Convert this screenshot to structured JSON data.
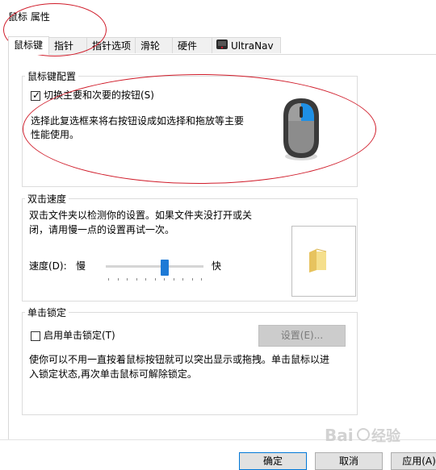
{
  "window": {
    "title": "鼠标 属性"
  },
  "tabs": [
    {
      "label": "鼠标键",
      "active": true
    },
    {
      "label": "指针"
    },
    {
      "label": "指针选项"
    },
    {
      "label": "滑轮"
    },
    {
      "label": "硬件"
    },
    {
      "label": "UltraNav",
      "icon": "ultranav-icon"
    }
  ],
  "button_config": {
    "legend": "鼠标键配置",
    "checkbox_label": "切换主要和次要的按钮(S)",
    "checked": true,
    "description_line1": "选择此复选框来将右按钮设成如选择和拖放等主要",
    "description_line2": "性能使用。",
    "illustration": "mouse-icon"
  },
  "double_click": {
    "legend": "双击速度",
    "description_line1": "双击文件夹以检测你的设置。如果文件夹没打开或关",
    "description_line2": "闭，请用慢一点的设置再试一次。",
    "speed_label": "速度(D):",
    "slow": "慢",
    "fast": "快",
    "speed_fraction": 0.6,
    "test_icon": "folder-icon"
  },
  "click_lock": {
    "legend": "单击锁定",
    "checkbox_label": "启用单击锁定(T)",
    "checked": false,
    "settings_button": "设置(E)...",
    "description_line1": "使你可以不用一直按着鼠标按钮就可以突出显示或拖拽。单击鼠标以进",
    "description_line2": "入锁定状态,再次单击鼠标可解除锁定。"
  },
  "footer": {
    "ok": "确定",
    "cancel": "取消",
    "apply": "应用(A)"
  },
  "colors": {
    "annotation": "#d01c2a",
    "accent": "#0078d7"
  }
}
